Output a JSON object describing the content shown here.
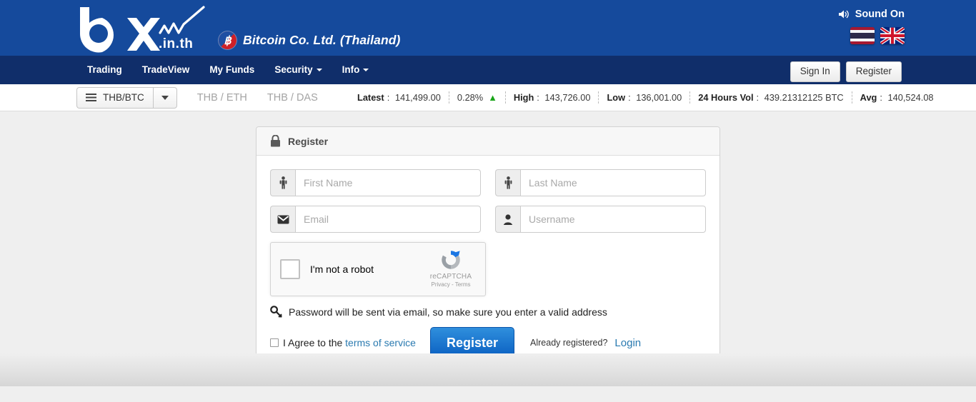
{
  "header": {
    "logo_main": "bx",
    "logo_tld": ".in.th",
    "company_name": "Bitcoin Co. Ltd. (Thailand)",
    "sound_label": "Sound On",
    "sound_icon": "speaker-icon",
    "flags": [
      {
        "name": "thai-flag",
        "label": "Thai"
      },
      {
        "name": "uk-flag",
        "label": "English"
      }
    ]
  },
  "nav": {
    "items": [
      {
        "label": "Trading",
        "has_caret": false
      },
      {
        "label": "TradeView",
        "has_caret": false
      },
      {
        "label": "My Funds",
        "has_caret": false
      },
      {
        "label": "Security",
        "has_caret": true
      },
      {
        "label": "Info",
        "has_caret": true
      }
    ],
    "sign_in": "Sign In",
    "register": "Register"
  },
  "ticker": {
    "selected_pair": "THB/BTC",
    "menu_icon": "hamburger-icon",
    "caret_icon": "chevron-down-icon",
    "alt_pairs": [
      "THB / ETH",
      "THB / DAS"
    ],
    "stats": [
      {
        "label": "Latest",
        "value": "141,499.00"
      },
      {
        "label": "",
        "value": "0.28%",
        "arrow": "▲",
        "arrow_color": "#19a519"
      },
      {
        "label": "High",
        "value": "143,726.00"
      },
      {
        "label": "Low",
        "value": "136,001.00"
      },
      {
        "label": "24 Hours Vol",
        "value": "439.21312125 BTC"
      },
      {
        "label": "Avg",
        "value": "140,524.08"
      }
    ]
  },
  "register_panel": {
    "title": "Register",
    "title_icon": "lock-icon",
    "fields": [
      {
        "name": "first-name",
        "placeholder": "First Name",
        "value": "",
        "icon": "person-icon"
      },
      {
        "name": "last-name",
        "placeholder": "Last Name",
        "value": "",
        "icon": "person-icon"
      },
      {
        "name": "email",
        "placeholder": "Email",
        "value": "",
        "icon": "envelope-icon"
      },
      {
        "name": "username",
        "placeholder": "Username",
        "value": "",
        "icon": "user-icon"
      }
    ],
    "recaptcha": {
      "checkbox_label": "I'm not a robot",
      "brand": "reCAPTCHA",
      "links": "Privacy - Terms"
    },
    "password_note": "Password will be sent via email, so make sure you enter a valid address",
    "password_note_icon": "key-icon",
    "terms_prefix": "I Agree to the ",
    "terms_link": "terms of service",
    "submit_label": "Register",
    "already_text": "Already registered?",
    "login_link": "Login"
  },
  "colors": {
    "header_blue": "#154a9c",
    "nav_blue": "#102e6a",
    "link_blue": "#2a7ab0",
    "button_blue": "#0a5fc1",
    "up_green": "#19a519",
    "page_bg": "#efefef"
  }
}
